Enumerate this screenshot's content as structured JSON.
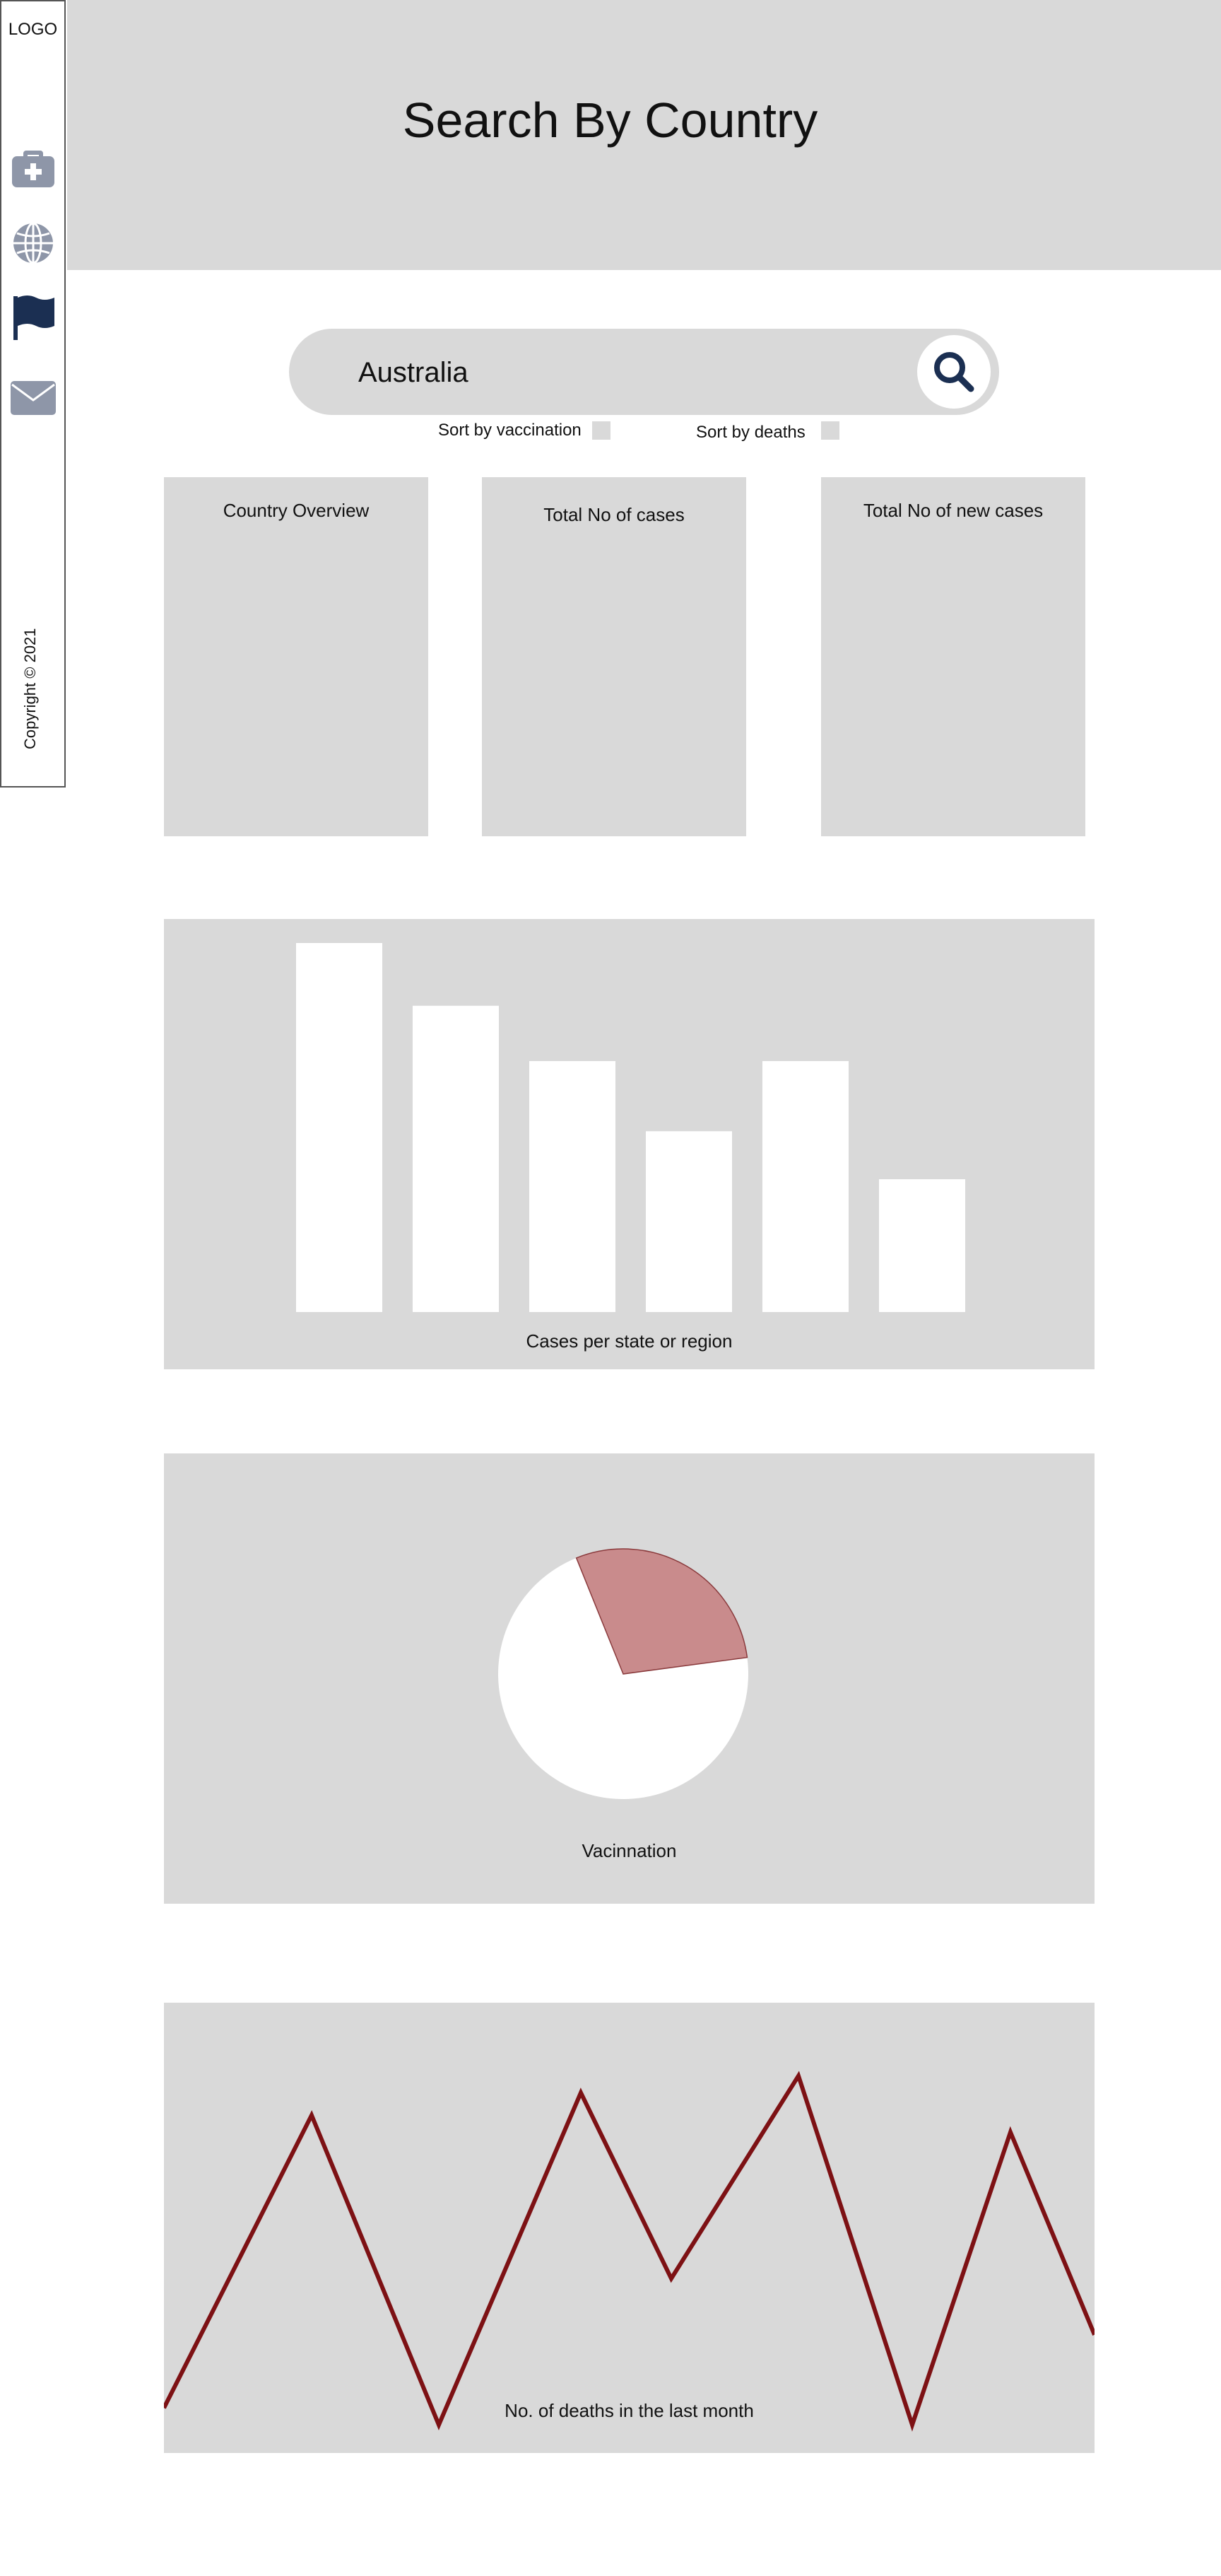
{
  "sidebar": {
    "logo": "LOGO",
    "icons": [
      "first-aid-kit-icon",
      "globe-icon",
      "flag-icon",
      "envelope-icon"
    ],
    "copyright": "Copyright © 2021"
  },
  "header": {
    "title": "Search By Country"
  },
  "search": {
    "value": "Australia",
    "button_icon": "search-icon"
  },
  "sort_options": [
    {
      "label": "Sort by vaccination",
      "checked": false
    },
    {
      "label": "Sort by deaths",
      "checked": false
    }
  ],
  "cards": [
    {
      "title": "Country Overview"
    },
    {
      "title": "Total No of cases"
    },
    {
      "title": "Total No of new cases"
    }
  ],
  "colors": {
    "panel": "#d9d9d9",
    "icon_gray": "#8e96a8",
    "icon_navy": "#1b2f52",
    "pie_slice": "#c98b8c",
    "pie_stroke": "#8a3a3c",
    "line": "#7d1114"
  },
  "chart_data": [
    {
      "type": "bar",
      "title": "Cases per state or region",
      "categories": [
        "",
        "",
        "",
        "",
        "",
        ""
      ],
      "values": [
        100,
        83,
        68,
        49,
        68,
        36
      ],
      "ylim": [
        0,
        100
      ]
    },
    {
      "type": "pie",
      "title": "Vacinnation",
      "values": [
        29,
        71
      ]
    },
    {
      "type": "line",
      "title": "No. of deaths in the last month",
      "x": [
        1,
        2,
        3,
        4,
        5,
        6,
        7,
        8,
        9
      ],
      "values": [
        8,
        60,
        5,
        64,
        31,
        67,
        5,
        57,
        21
      ],
      "ylim": [
        0,
        80
      ]
    }
  ]
}
